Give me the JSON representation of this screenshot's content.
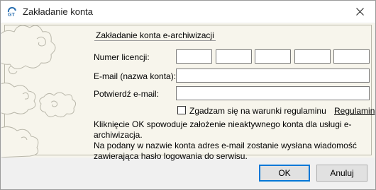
{
  "window": {
    "title": "Zakładanie konta",
    "close_icon": "close-icon",
    "app_icon": "gt-logo-icon"
  },
  "form": {
    "section_title": "Zakładanie konta e-archiwizacji",
    "license_label": "Numer licencji:",
    "license_fields": [
      "",
      "",
      "",
      "",
      ""
    ],
    "email_label": "E-mail (nazwa konta):",
    "email_value": "",
    "confirm_label": "Potwierdź e-mail:",
    "confirm_value": "",
    "terms_checkbox_label": "Zgadzam się na warunki regulaminu",
    "terms_checked": false,
    "terms_link": "Regulamin",
    "info_lines": [
      "Kliknięcie OK spowoduje założenie nieaktywnego konta dla usługi e-archiwizacja.",
      "Na podany w nazwie konta adres e-mail zostanie wysłana wiadomość",
      "zawierająca hasło logowania do serwisu."
    ]
  },
  "buttons": {
    "ok": "OK",
    "cancel": "Anuluj"
  },
  "colors": {
    "panel_bg": "#f7f5ec",
    "accent": "#0078d7"
  }
}
